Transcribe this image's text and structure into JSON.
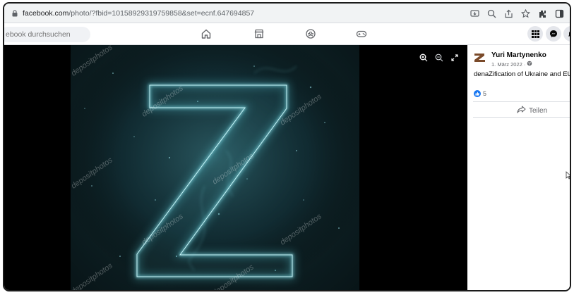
{
  "browser": {
    "url_host": "facebook.com",
    "url_path": "/photo/?fbid=10158929319759858&set=ecnf.647694857"
  },
  "fb_header": {
    "search_placeholder": "ebook durchsuchen"
  },
  "photo": {
    "subject_letter": "Z",
    "watermark_text": "depositphotos",
    "accent_color": "#5fd7e4"
  },
  "post": {
    "author": "Yuri Martynenko",
    "date": "1. März 2022 ·",
    "caption": "denaZification of Ukraine and EU",
    "reaction_count": "5",
    "share_label": "Teilen"
  }
}
